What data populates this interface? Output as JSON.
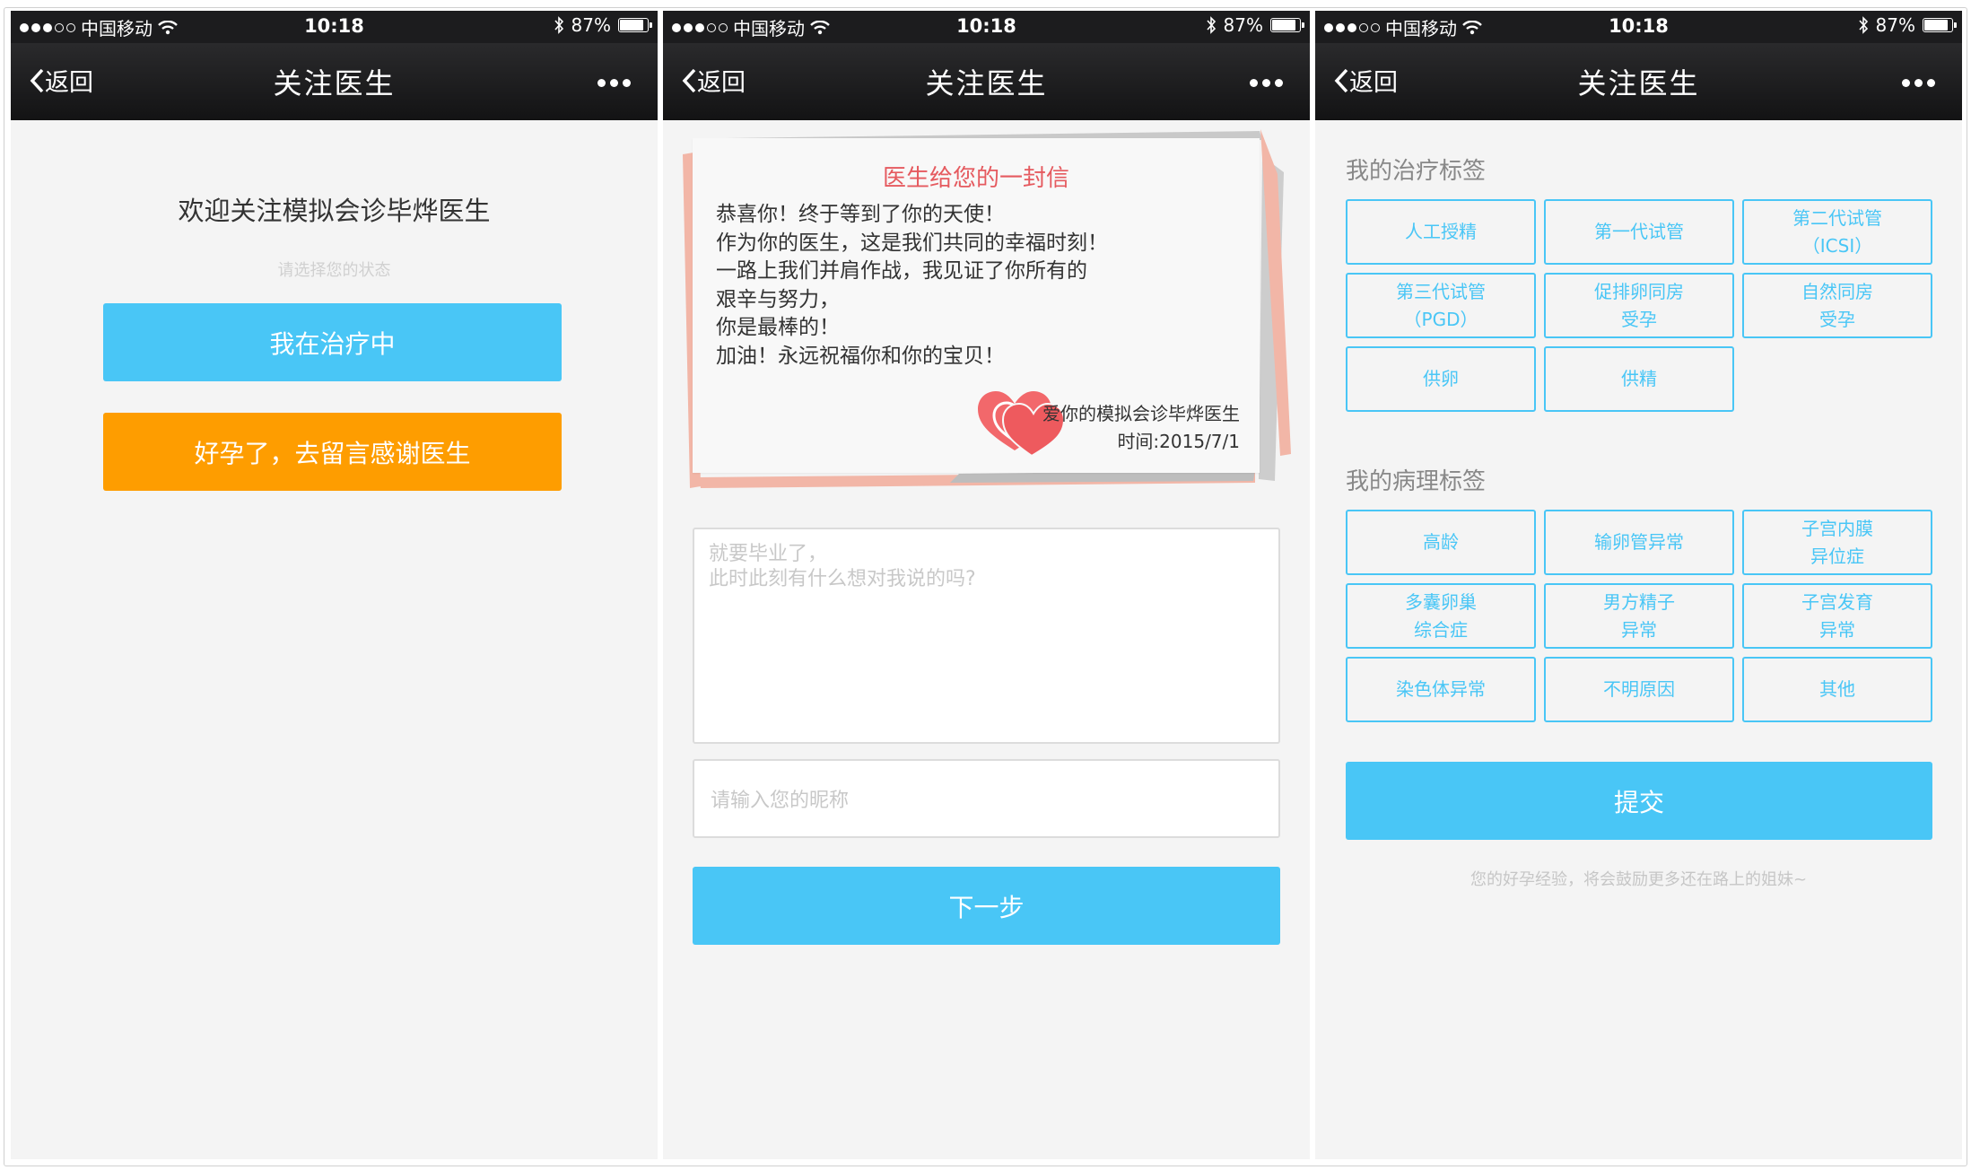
{
  "status": {
    "carrier": "中国移动",
    "time": "10:18",
    "battery": "87%",
    "battery_level": 0.87
  },
  "nav": {
    "back": "返回",
    "title": "关注医生"
  },
  "screen1": {
    "welcome": "欢迎关注模拟会诊毕烨医生",
    "hint": "请选择您的状态",
    "btn_treating": "我在治疗中",
    "btn_pregnant": "好孕了，去留言感谢医生"
  },
  "screen2": {
    "letter_title": "医生给您的一封信",
    "letter_lines": [
      "恭喜你！终于等到了你的天使！",
      "作为你的医生，这是我们共同的幸福时刻！",
      "一路上我们并肩作战，我见证了你所有的",
      "艰辛与努力，",
      "你是最棒的！",
      "加油！永远祝福你和你的宝贝！"
    ],
    "signature": "爱你的模拟会诊毕烨医生",
    "date": "时间:2015/7/1",
    "message_placeholder_1": "就要毕业了，",
    "message_placeholder_2": "此时此刻有什么想对我说的吗?",
    "nickname_placeholder": "请输入您的昵称",
    "next": "下一步"
  },
  "screen3": {
    "treatment_title": "我的治疗标签",
    "treatment_tags": [
      [
        "人工授精",
        ""
      ],
      [
        "第一代试管",
        ""
      ],
      [
        "第二代试管",
        "（ICSI）"
      ],
      [
        "第三代试管",
        "（PGD）"
      ],
      [
        "促排卵同房",
        "受孕"
      ],
      [
        "自然同房",
        "受孕"
      ],
      [
        "供卵",
        ""
      ],
      [
        "供精",
        ""
      ]
    ],
    "pathology_title": "我的病理标签",
    "pathology_tags": [
      [
        "高龄",
        ""
      ],
      [
        "输卵管异常",
        ""
      ],
      [
        "子宫内膜",
        "异位症"
      ],
      [
        "多囊卵巢",
        "综合症"
      ],
      [
        "男方精子",
        "异常"
      ],
      [
        "子宫发育",
        "异常"
      ],
      [
        "染色体异常",
        ""
      ],
      [
        "不明原因",
        ""
      ],
      [
        "其他",
        ""
      ]
    ],
    "submit": "提交",
    "footer": "您的好孕经验，将会鼓励更多还在路上的姐妹~"
  },
  "colors": {
    "accent_blue": "#49c6f6",
    "accent_orange": "#fe9d00",
    "letter_red": "#e55a5f"
  }
}
